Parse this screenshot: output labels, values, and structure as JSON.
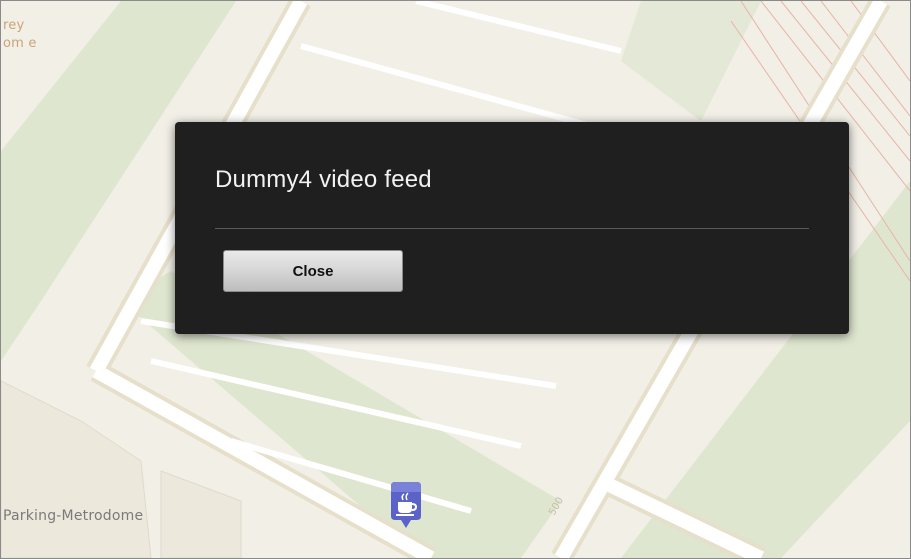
{
  "map": {
    "labels": {
      "top_left_line1": "rey",
      "top_left_line2": "om e",
      "bottom_left": "Parking-Metrodome",
      "street_number": "500"
    },
    "colors": {
      "land": "#f1efe6",
      "park": "#dfe6cf",
      "road": "#ffffff",
      "road_outline": "#e6dfca",
      "rail": "#e8b4a8"
    },
    "poi_icon": "coffee-cup-icon"
  },
  "dialog": {
    "title": "Dummy4 video feed",
    "close_label": "Close"
  }
}
